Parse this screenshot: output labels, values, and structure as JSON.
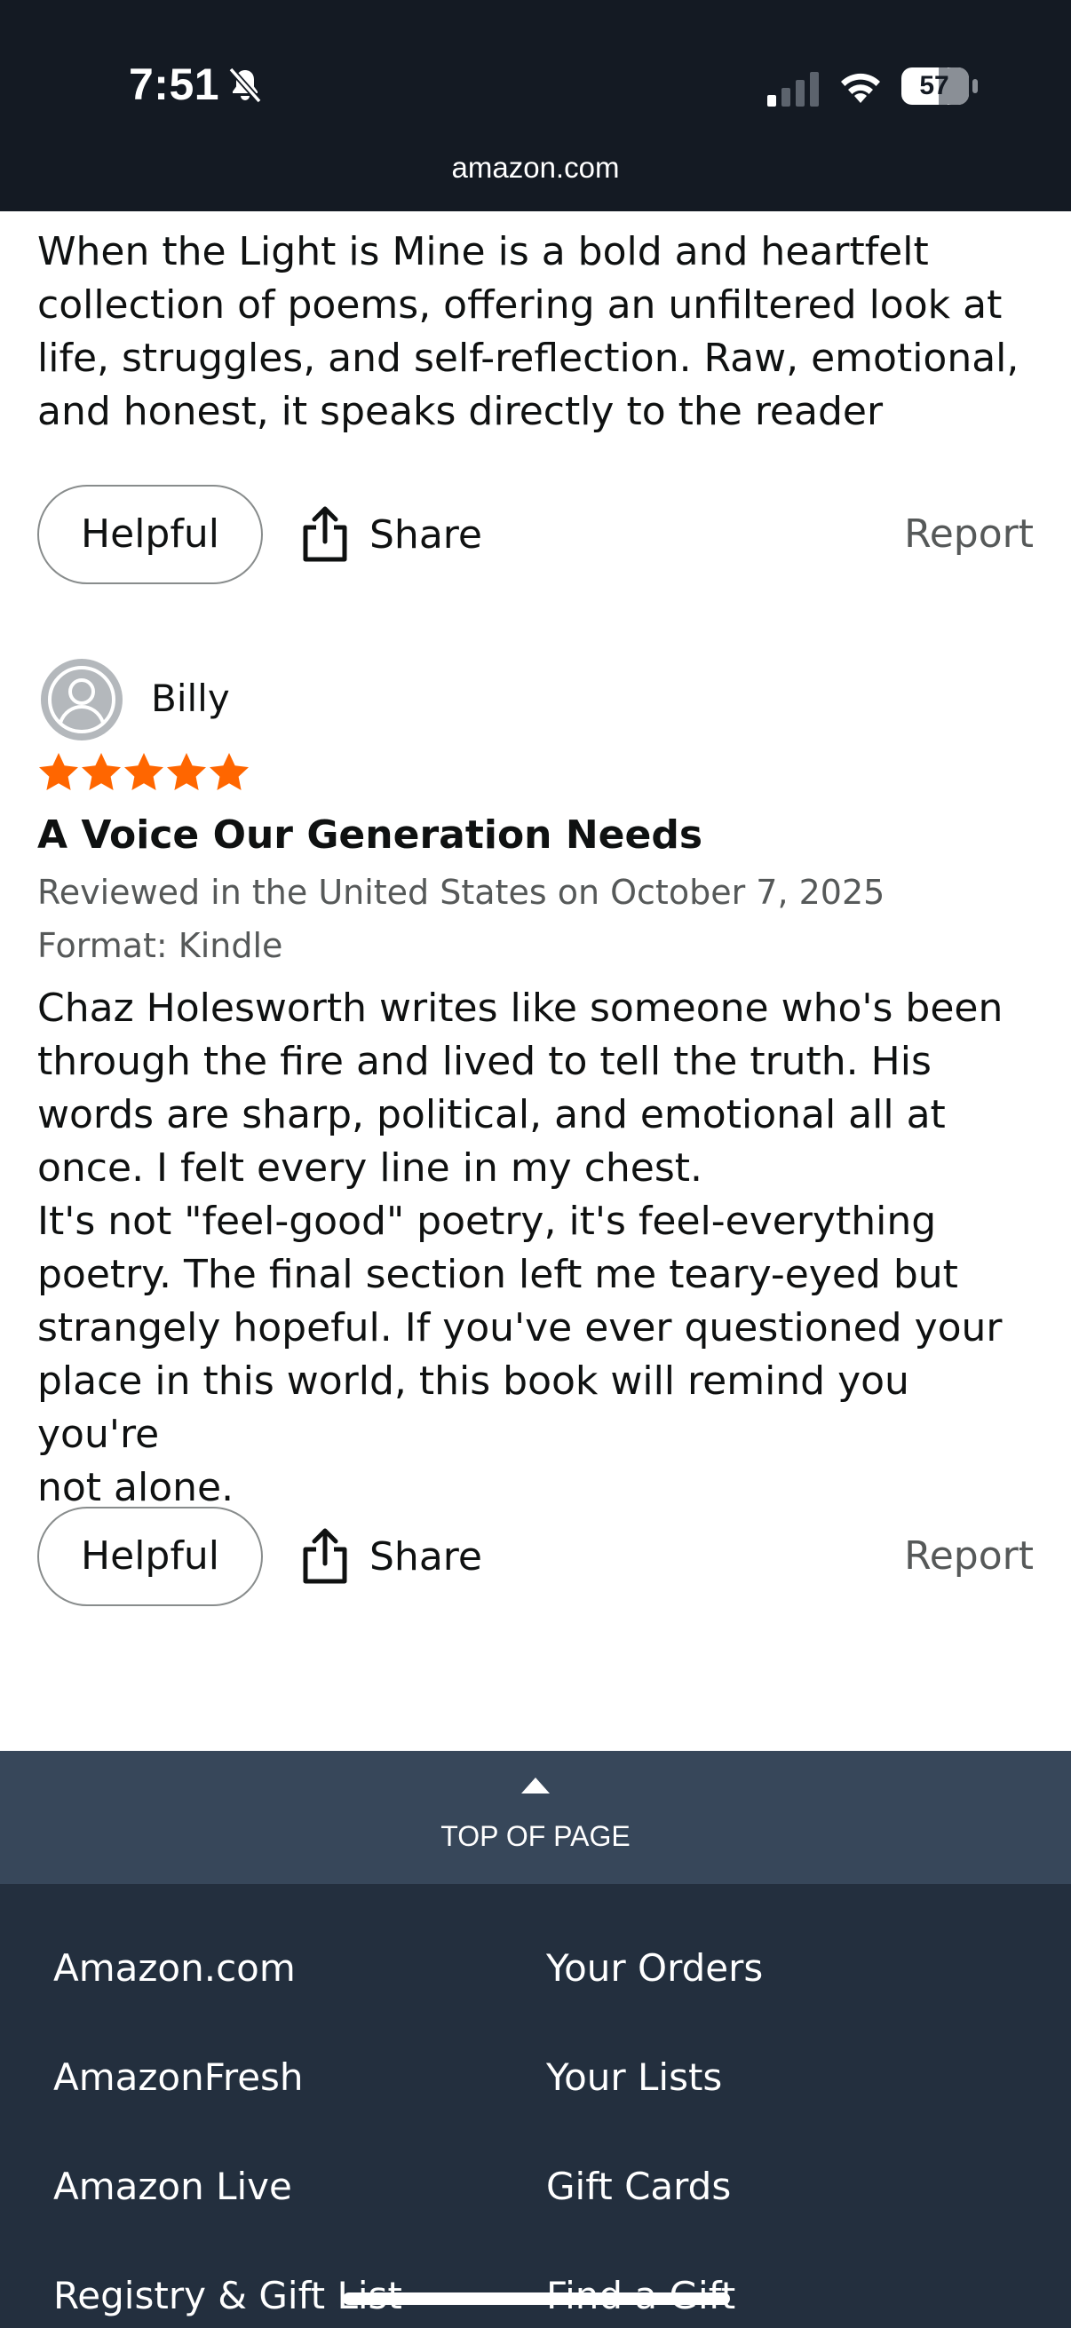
{
  "status_bar": {
    "time": "7:51",
    "battery": "57",
    "url": "amazon.com"
  },
  "review1": {
    "body": "When the Light is Mine is a bold and heartfelt\ncollection of poems, offering an unfiltered look at\nlife, struggles, and self-reflection. Raw, emotional,\nand honest, it speaks directly to the reader",
    "helpful_label": "Helpful",
    "share_label": "Share",
    "report_label": "Report"
  },
  "review2": {
    "reviewer": "Billy",
    "rating": 5,
    "star_color": "#ff6600",
    "title": "A Voice Our Generation Needs",
    "date_line": "Reviewed in the United States on October 7, 2025",
    "format_line": "Format: Kindle",
    "body": "Chaz Holesworth writes like someone who's been\nthrough the fire and lived to tell the truth. His\nwords are sharp, political, and emotional all at\nonce. I felt every line in my chest.\nIt's not \"feel-good\" poetry, it's feel-everything\npoetry. The final section left me teary-eyed but\nstrangely hopeful. If you've ever questioned your\nplace in this world, this book will remind you you're\nnot alone.",
    "helpful_label": "Helpful",
    "share_label": "Share",
    "report_label": "Report"
  },
  "footer": {
    "top_of_page": "TOP OF PAGE",
    "links_left": [
      "Amazon.com",
      "AmazonFresh",
      "Amazon Live",
      "Registry & Gift List"
    ],
    "links_right": [
      "Your Orders",
      "Your Lists",
      "Gift Cards",
      "Find a Gift"
    ]
  },
  "colors": {
    "status_bg": "#141a23",
    "top_of_page_bg": "#37475a",
    "footer_bg": "#232f3e"
  }
}
